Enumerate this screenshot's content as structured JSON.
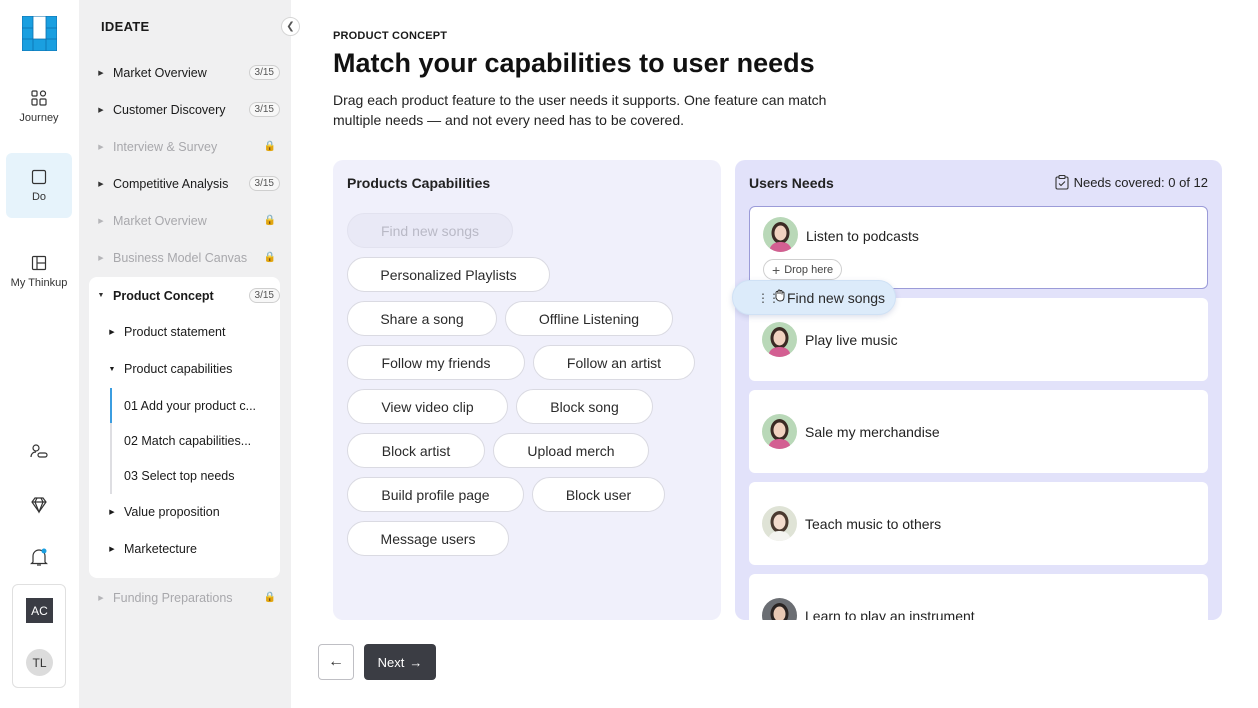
{
  "rail": {
    "items": [
      {
        "label": "Journey"
      },
      {
        "label": "Do"
      },
      {
        "label": "My Thinkup"
      }
    ],
    "user_initials": [
      "AC",
      "TL"
    ]
  },
  "sidebar": {
    "title": "IDEATE",
    "collapse_icon": "chevron-left-icon",
    "sections": [
      {
        "label": "Market Overview",
        "badge": "3/15",
        "disabled": false
      },
      {
        "label": "Customer Discovery",
        "badge": "3/15",
        "disabled": false
      },
      {
        "label": "Interview & Survey",
        "badge": "",
        "disabled": true
      },
      {
        "label": "Competitive Analysis",
        "badge": "3/15",
        "disabled": false
      },
      {
        "label": "Market Overview",
        "badge": "",
        "disabled": true
      },
      {
        "label": "Business Model Canvas",
        "badge": "",
        "disabled": true
      },
      {
        "label": "Product Concept",
        "badge": "3/15",
        "disabled": false,
        "expanded": true
      },
      {
        "label": "Funding Preparations",
        "badge": "",
        "disabled": true
      }
    ],
    "concept_children": [
      "Product statement",
      "Product capabilities",
      "Value proposition",
      "Marketecture"
    ],
    "steps": [
      "01  Add your product c...",
      "02  Match capabilities...",
      "03  Select top needs"
    ]
  },
  "main": {
    "eyebrow": "PRODUCT CONCEPT",
    "title": "Match your capabilities to user needs",
    "description": "Drag each product feature to the user needs it supports. One feature can match multiple needs — and not every need has to be covered."
  },
  "capabilities": {
    "title": "Products Capabilities",
    "chips": [
      "Find new songs",
      "Personalized Playlists",
      "Share a song",
      "Offline Listening",
      "Follow my friends",
      "Follow an artist",
      "View video clip",
      "Block song",
      "Block artist",
      "Upload merch",
      "Build profile page",
      "Block user",
      "Message users"
    ]
  },
  "needs": {
    "title": "Users Needs",
    "covered": "Needs covered: 0 of 12",
    "drop_label": "Drop here",
    "items": [
      "Listen to podcasts",
      "Play live music",
      "Sale my merchandise",
      "Teach music to others",
      "Learn to play an instrument"
    ]
  },
  "dragging": {
    "label": "Find new songs"
  },
  "nav_buttons": {
    "next": "Next"
  },
  "colors": {
    "accent": "#3b9de0",
    "dark_button": "#3b3d44",
    "needs_panel": "#e2e2fa",
    "capabilities_panel": "#f0f0fb"
  }
}
